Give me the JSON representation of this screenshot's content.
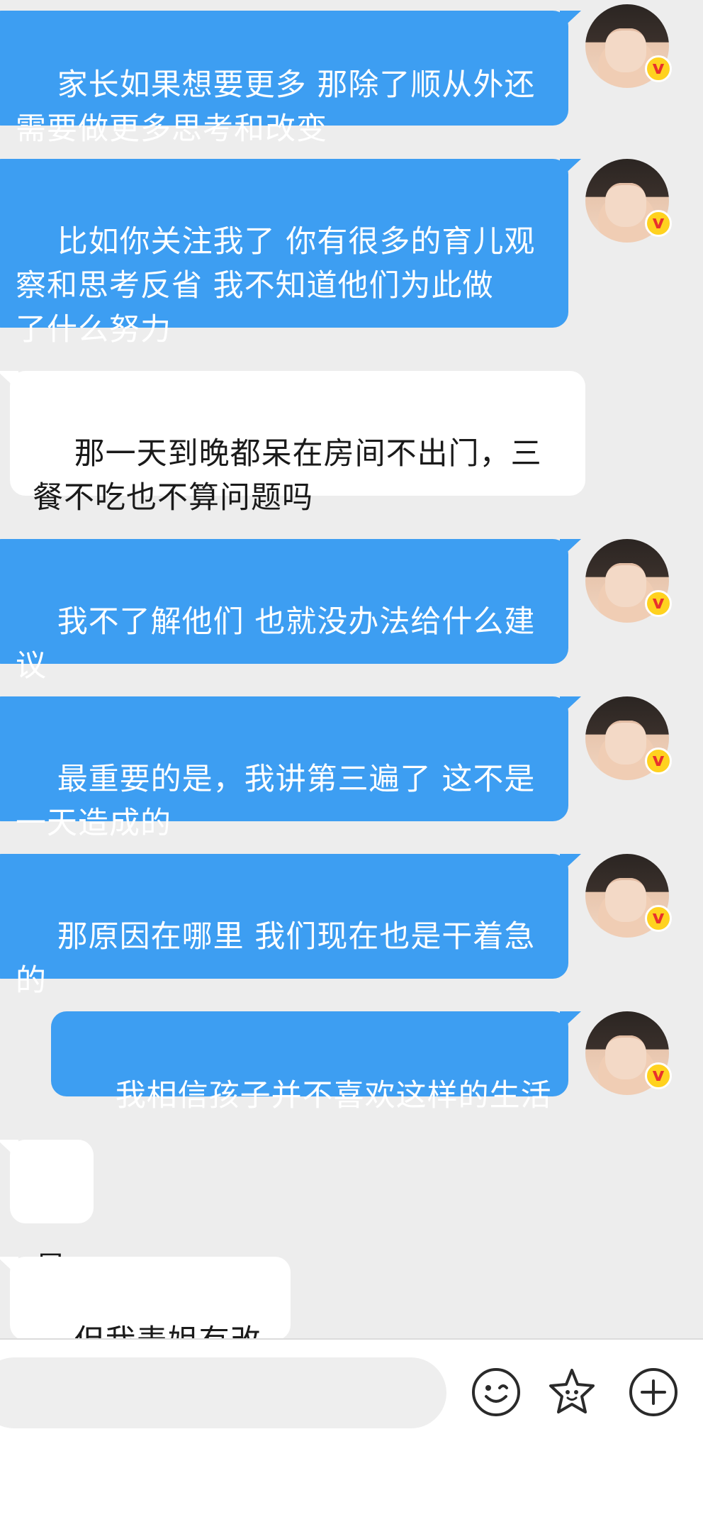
{
  "messages": [
    {
      "side": "out",
      "text": "家长如果想要更多 那除了顺从外还\n需要做更多思考和改变"
    },
    {
      "side": "out",
      "text": "比如你关注我了 你有很多的育儿观\n察和思考反省 我不知道他们为此做\n了什么努力"
    },
    {
      "side": "in",
      "text": "那一天到晚都呆在房间不出门，三\n餐不吃也不算问题吗"
    },
    {
      "side": "out",
      "text": "我不了解他们 也就没办法给什么建\n议"
    },
    {
      "side": "out",
      "text": "最重要的是，我讲第三遍了 这不是\n一天造成的"
    },
    {
      "side": "out",
      "text": "那原因在哪里 我们现在也是干着急\n的"
    },
    {
      "side": "out",
      "text": "我相信孩子并不喜欢这样的生活"
    },
    {
      "side": "in",
      "text": "是"
    },
    {
      "side": "in",
      "text": "但我表姐有改变"
    }
  ],
  "avatar": {
    "badge": "v",
    "badge_color": "#ffd21f",
    "badge_text_color": "#e8312d"
  },
  "input": {
    "placeholder": "",
    "value": ""
  },
  "toolbar": {
    "icons": [
      "emoji-icon",
      "sticker-icon",
      "add-icon"
    ]
  },
  "colors": {
    "outgoing_bubble": "#3d9ef2",
    "incoming_bubble": "#ffffff",
    "background": "#ededed"
  }
}
